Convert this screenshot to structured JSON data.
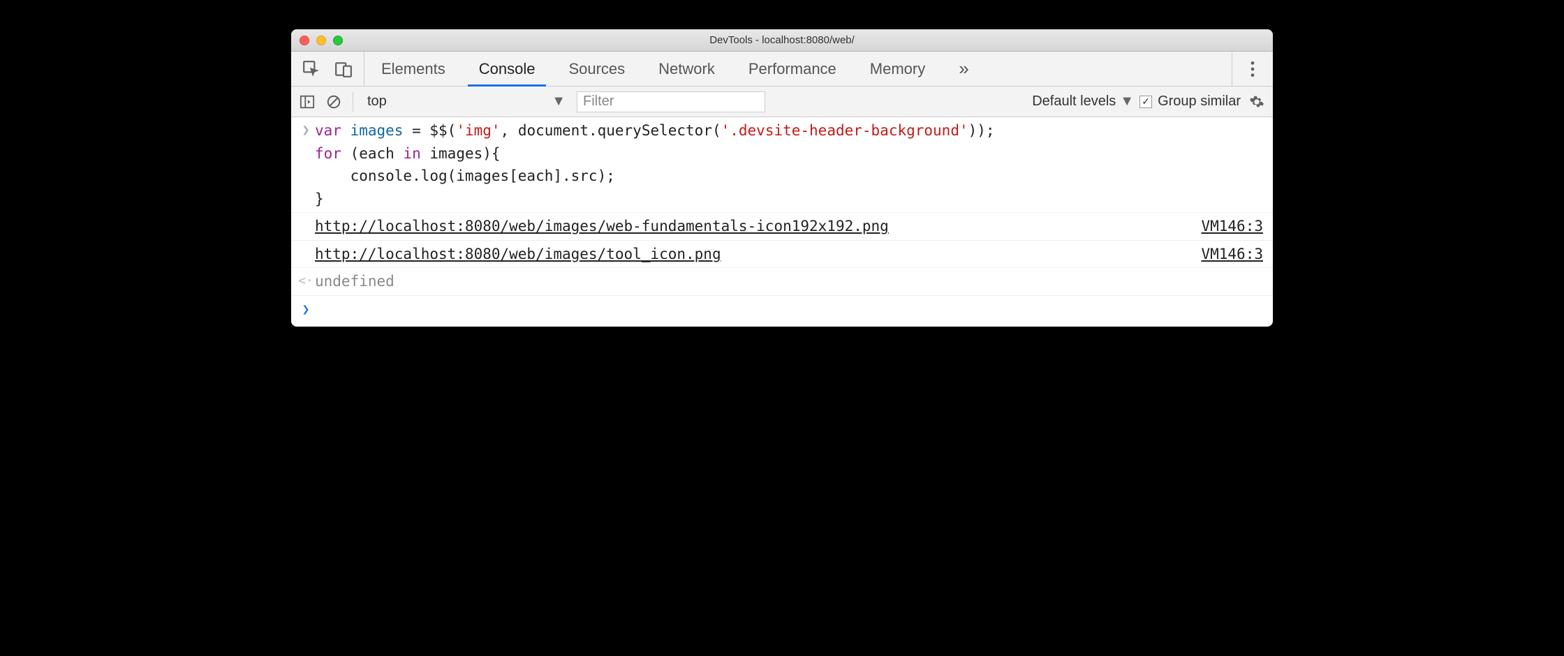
{
  "window": {
    "title": "DevTools - localhost:8080/web/"
  },
  "tabs": {
    "items": [
      "Elements",
      "Console",
      "Sources",
      "Network",
      "Performance",
      "Memory"
    ],
    "active_index": 1
  },
  "toolbar": {
    "context": "top",
    "filter_placeholder": "Filter",
    "levels_label": "Default levels",
    "group_similar_label": "Group similar",
    "group_similar_checked": true
  },
  "console": {
    "input_code": {
      "tokens": [
        {
          "t": "kw",
          "v": "var"
        },
        {
          "t": "plain",
          "v": " "
        },
        {
          "t": "var",
          "v": "images"
        },
        {
          "t": "plain",
          "v": " = $$("
        },
        {
          "t": "str",
          "v": "'img'"
        },
        {
          "t": "plain",
          "v": ", document.querySelector("
        },
        {
          "t": "str",
          "v": "'.devsite-header-background'"
        },
        {
          "t": "plain",
          "v": "));\n"
        },
        {
          "t": "kw",
          "v": "for"
        },
        {
          "t": "plain",
          "v": " (each "
        },
        {
          "t": "kw",
          "v": "in"
        },
        {
          "t": "plain",
          "v": " images){\n    console.log(images[each].src);\n}"
        }
      ]
    },
    "logs": [
      {
        "text": "http://localhost:8080/web/images/web-fundamentals-icon192x192.png",
        "source": "VM146:3"
      },
      {
        "text": "http://localhost:8080/web/images/tool_icon.png",
        "source": "VM146:3"
      }
    ],
    "return_value": "undefined"
  }
}
